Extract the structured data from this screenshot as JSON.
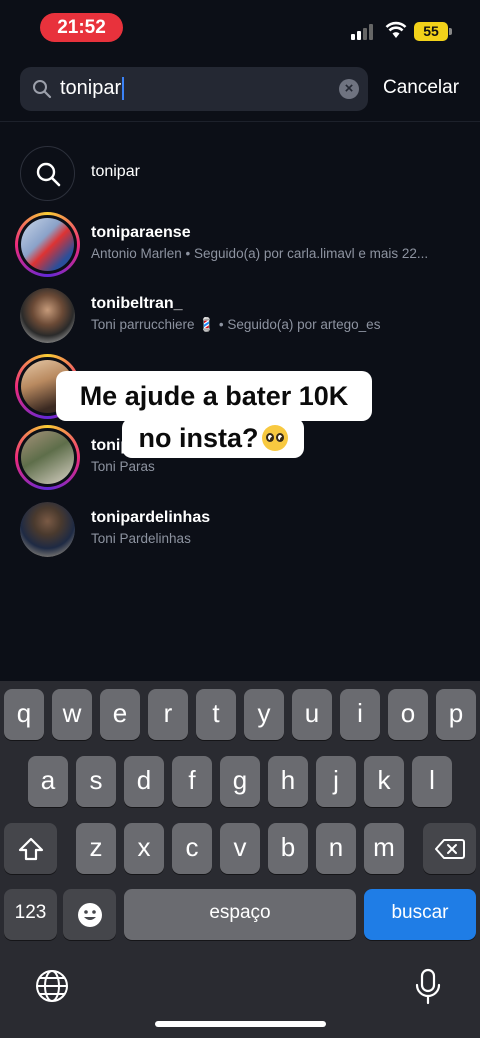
{
  "status": {
    "time": "21:52",
    "battery": "55"
  },
  "search": {
    "query": "tonipar",
    "cancel_label": "Cancelar",
    "clear_glyph": "×"
  },
  "results": [
    {
      "type": "query",
      "title": "tonipar"
    },
    {
      "type": "account",
      "username": "toniparaense",
      "subtitle": "Antonio Marlen • Seguido(a) por carla.limavl e mais 22...",
      "story_ring": true
    },
    {
      "type": "account",
      "username": "tonibeltran_",
      "subtitle": "Toni parrucchiere 💈 • Seguido(a) por artego_es",
      "story_ring": false
    },
    {
      "type": "account",
      "username": "",
      "subtitle": "",
      "story_ring": true
    },
    {
      "type": "account",
      "username": "tonip",
      "subtitle": "Toni Paras",
      "story_ring": true
    },
    {
      "type": "account",
      "username": "toniparde​linhas",
      "subtitle": "Toni Pardelinhas",
      "story_ring": false
    }
  ],
  "caption": {
    "line1": "Me ajude a bater 10K",
    "line2": "no insta?"
  },
  "keyboard": {
    "row1": [
      "q",
      "w",
      "e",
      "r",
      "t",
      "y",
      "u",
      "i",
      "o",
      "p"
    ],
    "row2": [
      "a",
      "s",
      "d",
      "f",
      "g",
      "h",
      "j",
      "k",
      "l"
    ],
    "row3": [
      "z",
      "x",
      "c",
      "v",
      "b",
      "n",
      "m"
    ],
    "numbers_label": "123",
    "space_label": "espaço",
    "search_label": "buscar"
  },
  "colors": {
    "accent": "#1f7de6",
    "caret": "#3b82f6",
    "time_pill": "#e8323c",
    "battery": "#f3d21a"
  }
}
